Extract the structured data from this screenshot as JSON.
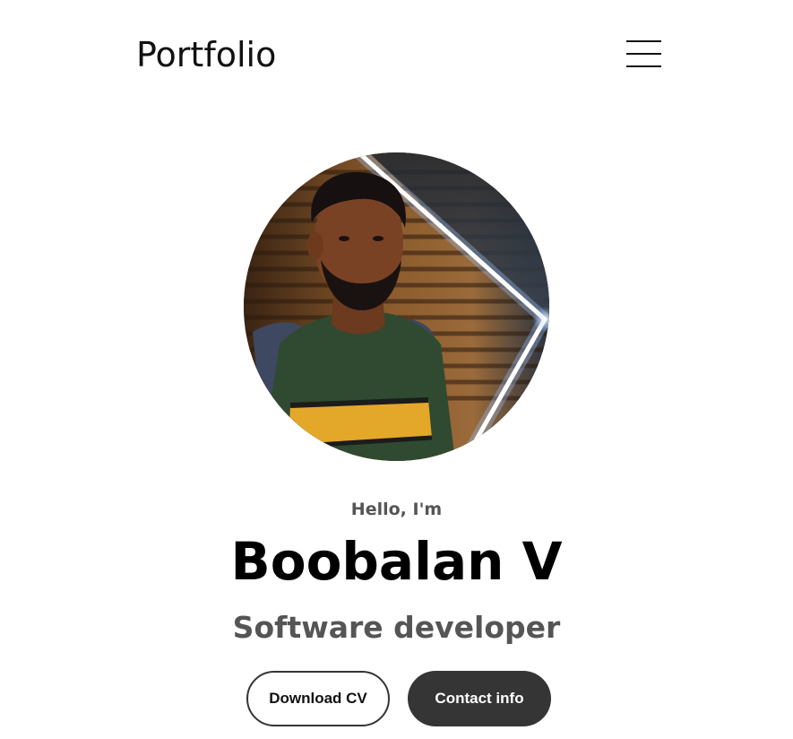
{
  "nav": {
    "logo": "Portfolio",
    "menu_icon": "hamburger-menu-icon"
  },
  "hero": {
    "greeting": "Hello, I'm",
    "name": "Boobalan V",
    "role": "Software developer",
    "buttons": {
      "download_cv": "Download CV",
      "contact_info": "Contact info"
    }
  },
  "colors": {
    "text_primary": "#000000",
    "text_secondary": "#555555",
    "button_dark": "#353535",
    "background": "#ffffff"
  }
}
